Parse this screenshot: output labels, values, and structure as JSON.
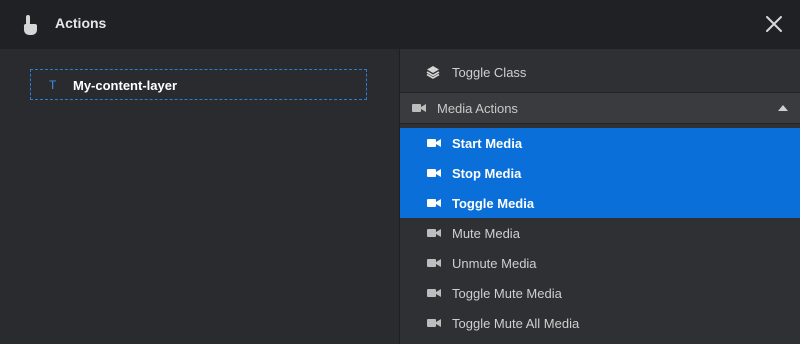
{
  "header": {
    "title": "Actions"
  },
  "layer": {
    "type_glyph": "T",
    "name": "My-content-layer"
  },
  "actions": {
    "toggle_class": "Toggle Class",
    "group": {
      "label": "Media Actions",
      "items": [
        {
          "label": "Start Media",
          "selected": true
        },
        {
          "label": "Stop Media",
          "selected": true
        },
        {
          "label": "Toggle Media",
          "selected": true
        },
        {
          "label": "Mute Media",
          "selected": false
        },
        {
          "label": "Unmute Media",
          "selected": false
        },
        {
          "label": "Toggle Mute Media",
          "selected": false
        },
        {
          "label": "Toggle Mute All Media",
          "selected": false
        }
      ]
    }
  },
  "colors": {
    "accent": "#0a6fd8",
    "layer_border": "#2b7cd3",
    "header_bg": "#202124"
  }
}
